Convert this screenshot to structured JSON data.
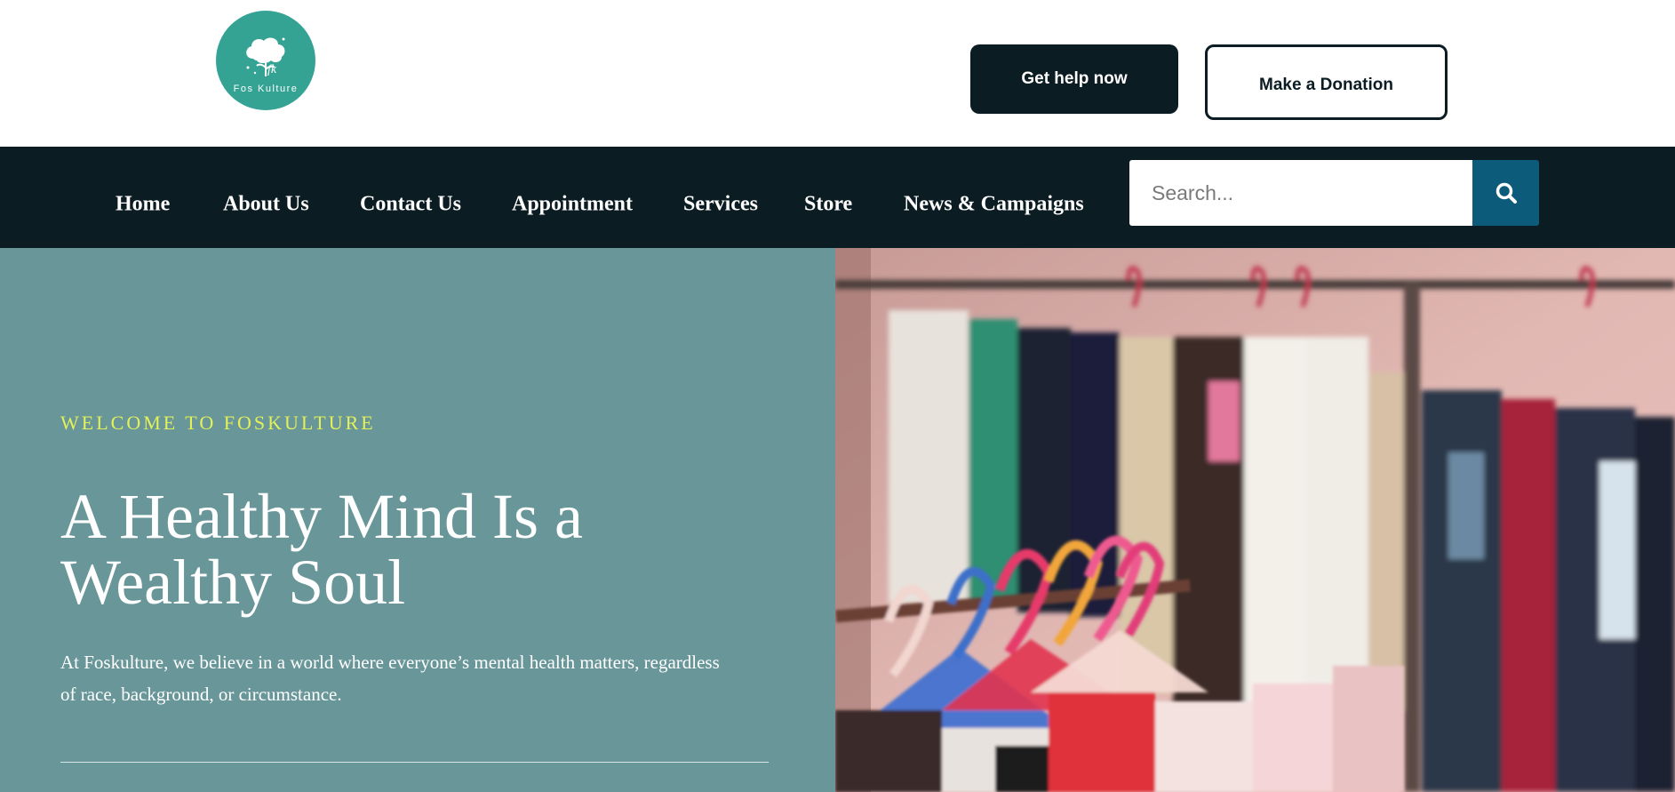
{
  "header": {
    "logo_text": "Fos Kulture",
    "help_button": "Get help now",
    "donate_button": "Make a Donation"
  },
  "nav": {
    "items": [
      {
        "label": "Home"
      },
      {
        "label": "About Us"
      },
      {
        "label": "Contact Us"
      },
      {
        "label": "Appointment"
      },
      {
        "label": "Services"
      },
      {
        "label": "Store"
      },
      {
        "label": "News & Campaigns"
      }
    ],
    "search_placeholder": "Search...",
    "search_icon": "search-icon"
  },
  "hero": {
    "eyebrow": "WELCOME TO FOSKULTURE",
    "headline": "A Healthy Mind Is a Wealthy Soul",
    "body": "At Foskulture, we believe in a world where everyone’s mental health matters, regardless of race, background, or circumstance.",
    "image": "clothing-rack-photo"
  },
  "colors": {
    "brand_teal": "#34a394",
    "dark_navy": "#0b1c23",
    "hero_bg": "#699699",
    "accent_yellow": "#e3f05a",
    "search_button": "#0d5b7a"
  }
}
